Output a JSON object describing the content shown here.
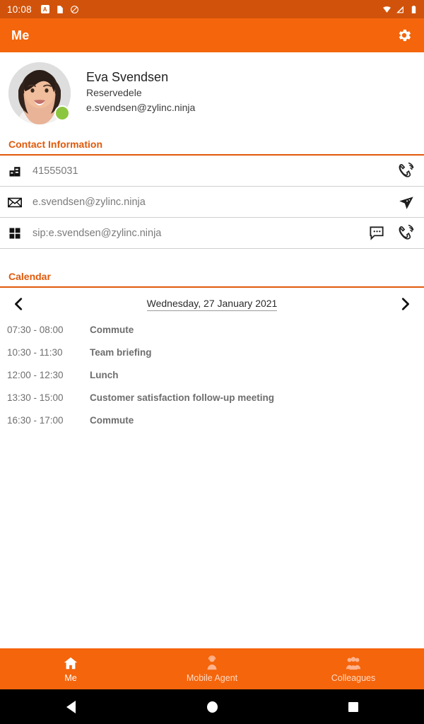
{
  "status_bar": {
    "time": "10:08",
    "left_icons": [
      "app-notification-icon",
      "sd-card-icon",
      "do-not-disturb-icon"
    ],
    "right_icons": [
      "wifi-icon",
      "cellular-signal-icon",
      "battery-icon"
    ],
    "background_color": "#D1530B"
  },
  "app_bar": {
    "title": "Me",
    "settings_icon": "gear-icon",
    "background_color": "#F4650C"
  },
  "profile": {
    "name": "Eva Svendsen",
    "department": "Reservedele",
    "email": "e.svendsen@zylinc.ninja",
    "presence_status_color": "#8CC63E",
    "avatar_icon": "user-photo-avatar"
  },
  "contact_section": {
    "title": "Contact Information",
    "accent_color": "#E0590B",
    "rows": [
      {
        "icon": "office-building-icon",
        "value": "41555031",
        "actions": [
          "call-icon"
        ]
      },
      {
        "icon": "envelope-icon",
        "value": "e.svendsen@zylinc.ninja",
        "actions": [
          "send-mail-icon"
        ]
      },
      {
        "icon": "grid-squares-icon",
        "value": "sip:e.svendsen@zylinc.ninja",
        "actions": [
          "chat-bubble-icon",
          "call-icon"
        ]
      }
    ]
  },
  "calendar_section": {
    "title": "Calendar",
    "prev_icon": "chevron-left-icon",
    "next_icon": "chevron-right-icon",
    "date": "Wednesday, 27 January 2021",
    "events": [
      {
        "time": "07:30 - 08:00",
        "title": "Commute"
      },
      {
        "time": "10:30 - 11:30",
        "title": "Team briefing"
      },
      {
        "time": "12:00 - 12:30",
        "title": "Lunch"
      },
      {
        "time": "13:30 - 15:00",
        "title": "Customer satisfaction follow-up meeting"
      },
      {
        "time": "16:30 - 17:00",
        "title": "Commute"
      }
    ]
  },
  "bottom_nav": {
    "items": [
      {
        "label": "Me",
        "icon": "home-icon",
        "active": true
      },
      {
        "label": "Mobile Agent",
        "icon": "person-agent-icon",
        "active": false
      },
      {
        "label": "Colleagues",
        "icon": "people-group-icon",
        "active": false
      }
    ]
  },
  "android_nav": {
    "back_icon": "back-triangle-icon",
    "home_icon": "home-circle-icon",
    "recents_icon": "recents-square-icon"
  }
}
